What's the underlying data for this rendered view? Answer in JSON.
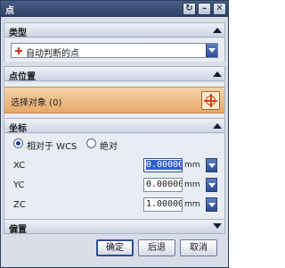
{
  "window": {
    "title": "点"
  },
  "sections": {
    "type": {
      "header": "类型",
      "selected_value": "自动判断的点"
    },
    "point_location": {
      "header": "点位置",
      "select_object_label": "选择对象 (0)"
    },
    "coordinates": {
      "header": "坐标",
      "radio_relative_label": "相对于 WCS",
      "radio_absolute_label": "绝对",
      "selected_radio": "relative",
      "rows": [
        {
          "label": "XC",
          "value": "0.000000",
          "unit": "mm"
        },
        {
          "label": "YC",
          "value": "0.000000",
          "unit": "mm"
        },
        {
          "label": "ZC",
          "value": "1.000000",
          "unit": "mm"
        }
      ]
    },
    "offset": {
      "header": "偏置"
    }
  },
  "buttons": {
    "ok": "确定",
    "back": "后退",
    "cancel": "取消"
  },
  "colors": {
    "title_bar": "#2c3f63",
    "select_object_highlight": "#e7a868",
    "point_icon": "#d2431a",
    "dropdown_accent": "#2a4c99"
  }
}
